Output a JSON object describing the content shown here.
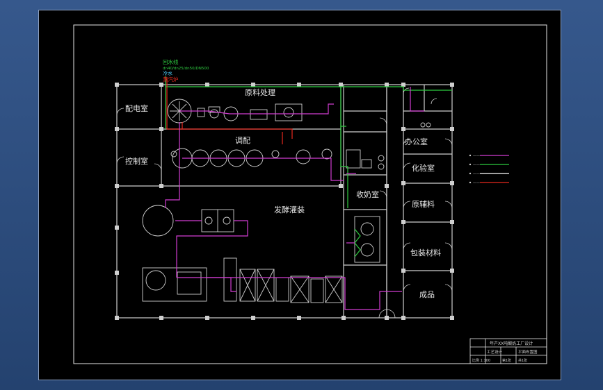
{
  "rooms": {
    "power_room": "配电室",
    "control_room": "控制室",
    "raw_processing": "原料处理",
    "blending": "调配",
    "fermentation_filling": "发酵灌装",
    "office": "办公室",
    "lab": "化验室",
    "milk_receiving": "收奶室",
    "auxiliary_materials": "原辅料",
    "packaging_materials": "包装材料",
    "finished_goods": "成品"
  },
  "pipe_legend": {
    "hot_water": "回水线",
    "cold_water": "冷水",
    "steam_boiler": "蒸汽炉",
    "spec": "dn40/dn25/dn50/DN500"
  },
  "legend_items": [
    "——",
    "——",
    "——",
    "——"
  ],
  "colors": {
    "wall": "#cfcfcf",
    "magenta": "#d23cd2",
    "green": "#2ecc40",
    "red": "#e8281e",
    "white": "#ffffff",
    "cyan": "#50d0ff"
  },
  "title_block": {
    "title": "年产XX吨酸奶工厂设计",
    "row2_left": "工艺设计",
    "row2_right": "平面布置图",
    "row3_left": "比例 1:100",
    "row3_mid": "第1张",
    "row3_right": "共1张"
  }
}
